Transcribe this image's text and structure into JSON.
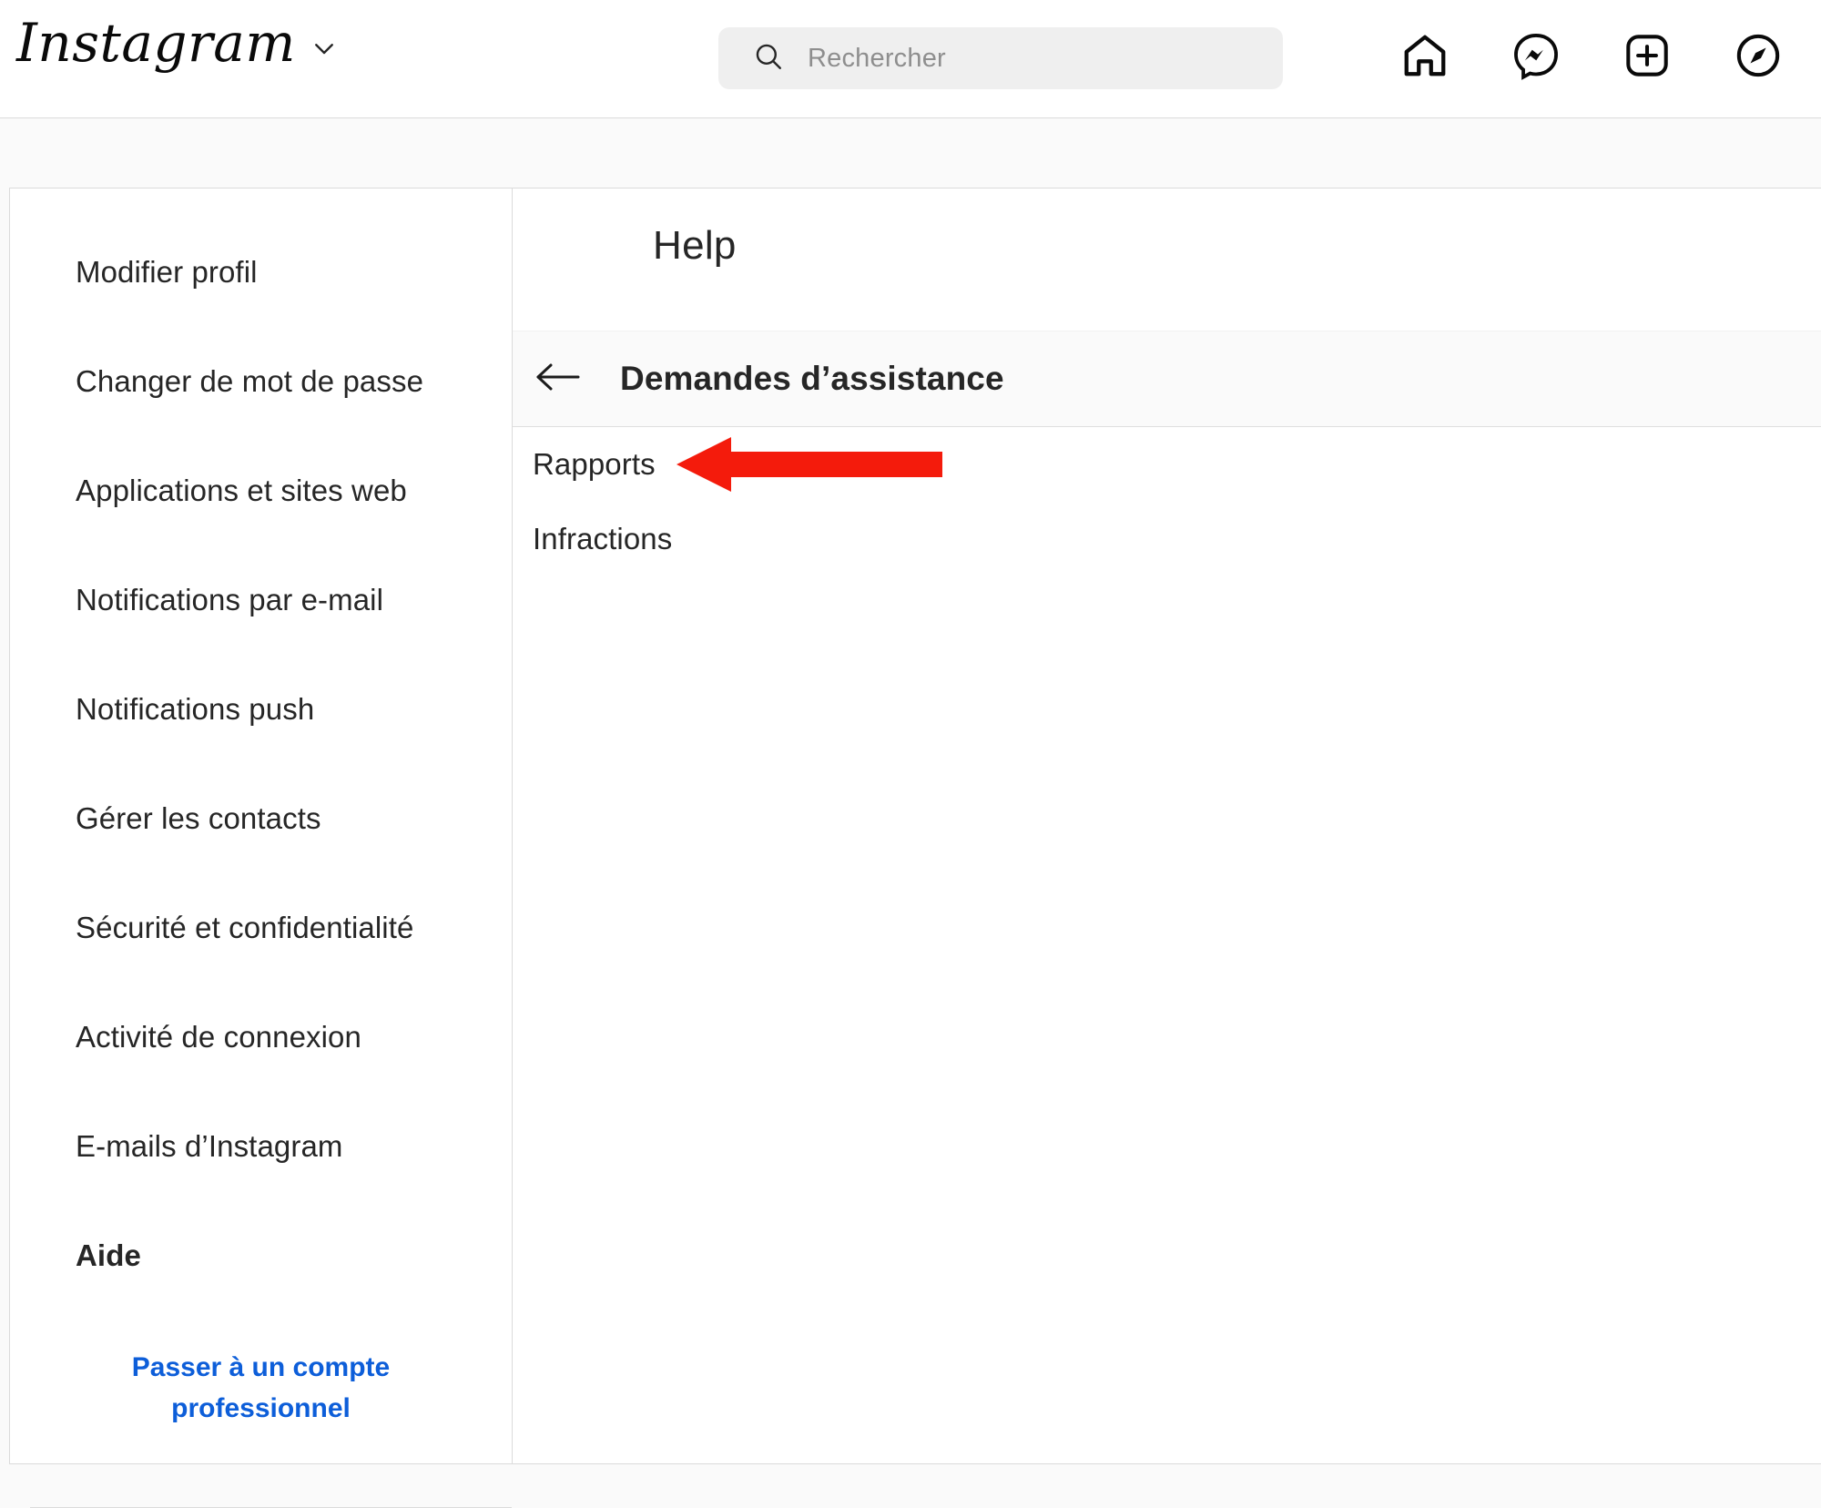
{
  "header": {
    "brand": "Instagram",
    "brand_chevron_icon": "chevron-down-icon",
    "search": {
      "placeholder": "Rechercher",
      "value": "",
      "icon": "search-icon"
    },
    "nav_icons": [
      {
        "name": "home-icon",
        "label": "Accueil"
      },
      {
        "name": "messenger-icon",
        "label": "Messages"
      },
      {
        "name": "new-post-icon",
        "label": "Nouvelle publication"
      },
      {
        "name": "explore-compass-icon",
        "label": "Explorer"
      }
    ]
  },
  "sidebar": {
    "items": [
      {
        "label": "Modifier profil",
        "active": false
      },
      {
        "label": "Changer de mot de passe",
        "active": false
      },
      {
        "label": "Applications et sites web",
        "active": false
      },
      {
        "label": "Notifications par e-mail",
        "active": false
      },
      {
        "label": "Notifications push",
        "active": false
      },
      {
        "label": "Gérer les contacts",
        "active": false
      },
      {
        "label": "Sécurité et confidentialité",
        "active": false
      },
      {
        "label": "Activité de connexion",
        "active": false
      },
      {
        "label": "E-mails d’Instagram",
        "active": false
      },
      {
        "label": "Aide",
        "active": true
      }
    ],
    "upgrade_link": "Passer à un compte professionnel"
  },
  "content": {
    "title": "Help",
    "section": {
      "back_icon": "arrow-left-icon",
      "title": "Demandes d’assistance"
    },
    "links": [
      {
        "label": "Rapports",
        "annotated": true
      },
      {
        "label": "Infractions",
        "annotated": false
      }
    ]
  },
  "annotation": {
    "type": "arrow-left",
    "color": "#f41b0c",
    "points_at": "Rapports"
  },
  "colors": {
    "page_background": "#fafafa",
    "surface": "#ffffff",
    "border": "#dbdbdb",
    "text_primary": "#262626",
    "text_muted": "#8e8e8e",
    "search_field": "#efefef",
    "link_blue": "#0d5ed9",
    "annotation_red": "#f41b0c"
  }
}
